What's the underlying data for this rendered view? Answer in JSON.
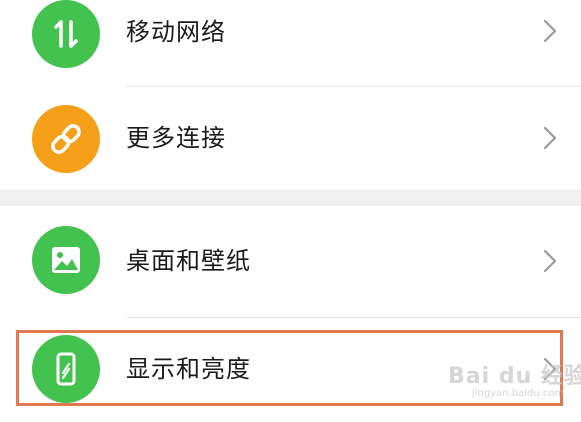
{
  "settings": {
    "items": [
      {
        "label": "移动网络",
        "icon": "mobile-data-icon",
        "color": "#43c24f"
      },
      {
        "label": "更多连接",
        "icon": "link-icon",
        "color": "#f6a01a"
      },
      {
        "label": "桌面和壁纸",
        "icon": "wallpaper-icon",
        "color": "#43c24f"
      },
      {
        "label": "显示和亮度",
        "icon": "display-brightness-icon",
        "color": "#43c24f",
        "highlighted": true
      }
    ]
  },
  "watermark": {
    "text": "Bai du 经验",
    "sub": "jingyan.baidu.com"
  },
  "colors": {
    "highlight_border": "#e07950",
    "section_gap": "#f0f0f0"
  }
}
